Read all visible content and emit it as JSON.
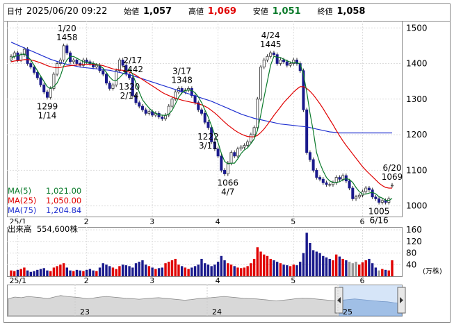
{
  "header": {
    "date_label": "日付",
    "datetime": "2025/06/20 09:22",
    "open_label": "始値",
    "open": "1,057",
    "high_label": "高値",
    "high": "1,069",
    "low_label": "安値",
    "low": "1,051",
    "close_label": "終値",
    "close": "1,058"
  },
  "ma": [
    {
      "label": "MA(5)",
      "value": "1,021.00",
      "color": "#0a7a2a"
    },
    {
      "label": "MA(25)",
      "value": "1,050.00",
      "color": "#e00000"
    },
    {
      "label": "MA(75)",
      "value": "1,204.84",
      "color": "#2030d0"
    }
  ],
  "volume": {
    "label": "出来高",
    "value": "554,600株",
    "unit": "(万株)"
  },
  "colors": {
    "up": "#e00000",
    "down": "#1a1a8c",
    "ma5": "#0a7a2a",
    "ma25": "#e00000",
    "ma75": "#2030d0",
    "vol_gray": "#999999"
  },
  "chart_data": {
    "type": "candlestick",
    "price_axis_ticks": [
      "1500",
      "1400",
      "1300",
      "1200",
      "1100",
      "1000"
    ],
    "price_ylim": [
      970,
      1520
    ],
    "volume_axis_ticks": [
      "160",
      "120",
      "80",
      "40"
    ],
    "volume_ylim": [
      0,
      170
    ],
    "month_labels": [
      "25/1",
      "2",
      "3",
      "4",
      "5",
      "6"
    ],
    "year_labels": [
      "23",
      "24",
      "25"
    ],
    "annotations": [
      {
        "date": "1/20",
        "value": "1458",
        "pos": "above"
      },
      {
        "date": "2/17",
        "value": "1442",
        "pos": "above"
      },
      {
        "date": "3/17",
        "value": "1348",
        "pos": "above"
      },
      {
        "date": "4/24",
        "value": "1445",
        "pos": "above"
      },
      {
        "date": "6/20",
        "value": "1069",
        "pos": "above"
      },
      {
        "date": "1/14",
        "value": "1299",
        "pos": "below"
      },
      {
        "date": "2/14",
        "value": "1320",
        "pos": "below"
      },
      {
        "date": "3/11",
        "value": "1222",
        "pos": "below"
      },
      {
        "date": "4/7",
        "value": "1066",
        "pos": "below"
      },
      {
        "date": "6/16",
        "value": "1005",
        "pos": "below"
      }
    ],
    "candles_close": [
      1420,
      1430,
      1410,
      1425,
      1440,
      1400,
      1390,
      1375,
      1360,
      1340,
      1320,
      1305,
      1330,
      1370,
      1400,
      1410,
      1450,
      1430,
      1405,
      1410,
      1400,
      1395,
      1410,
      1405,
      1400,
      1390,
      1395,
      1380,
      1370,
      1345,
      1330,
      1340,
      1380,
      1410,
      1395,
      1370,
      1360,
      1310,
      1290,
      1280,
      1270,
      1260,
      1265,
      1255,
      1260,
      1250,
      1245,
      1255,
      1280,
      1300,
      1320,
      1330,
      1320,
      1325,
      1330,
      1310,
      1290,
      1270,
      1260,
      1235,
      1220,
      1180,
      1160,
      1140,
      1100,
      1090,
      1120,
      1150,
      1140,
      1160,
      1165,
      1170,
      1180,
      1200,
      1220,
      1300,
      1390,
      1410,
      1420,
      1430,
      1425,
      1400,
      1410,
      1405,
      1395,
      1400,
      1410,
      1400,
      1380,
      1270,
      1150,
      1130,
      1100,
      1080,
      1075,
      1065,
      1060,
      1060,
      1065,
      1080,
      1075,
      1085,
      1070,
      1050,
      1020,
      1025,
      1030,
      1040,
      1050,
      1045,
      1025,
      1020,
      1010,
      1015,
      1010,
      1020,
      1058
    ],
    "candles_open": [
      1410,
      1420,
      1430,
      1410,
      1425,
      1440,
      1400,
      1390,
      1375,
      1360,
      1340,
      1320,
      1305,
      1330,
      1370,
      1400,
      1410,
      1450,
      1430,
      1405,
      1410,
      1400,
      1395,
      1410,
      1405,
      1400,
      1390,
      1395,
      1380,
      1370,
      1345,
      1330,
      1340,
      1380,
      1410,
      1395,
      1370,
      1360,
      1310,
      1290,
      1280,
      1270,
      1260,
      1265,
      1255,
      1260,
      1250,
      1245,
      1255,
      1280,
      1300,
      1320,
      1330,
      1320,
      1325,
      1330,
      1310,
      1290,
      1270,
      1260,
      1235,
      1220,
      1180,
      1160,
      1140,
      1100,
      1090,
      1120,
      1150,
      1140,
      1160,
      1165,
      1170,
      1180,
      1200,
      1220,
      1300,
      1390,
      1410,
      1420,
      1430,
      1425,
      1400,
      1410,
      1405,
      1395,
      1400,
      1410,
      1400,
      1380,
      1270,
      1150,
      1130,
      1100,
      1080,
      1075,
      1065,
      1060,
      1060,
      1065,
      1080,
      1075,
      1085,
      1070,
      1050,
      1020,
      1025,
      1030,
      1040,
      1050,
      1045,
      1025,
      1020,
      1010,
      1015,
      1010,
      1057
    ],
    "ma5": [
      1415,
      1420,
      1422,
      1425,
      1427,
      1420,
      1410,
      1395,
      1380,
      1365,
      1350,
      1335,
      1330,
      1335,
      1345,
      1365,
      1393,
      1410,
      1420,
      1420,
      1415,
      1410,
      1405,
      1402,
      1402,
      1400,
      1398,
      1394,
      1387,
      1375,
      1362,
      1353,
      1352,
      1360,
      1370,
      1377,
      1385,
      1370,
      1345,
      1320,
      1298,
      1286,
      1275,
      1266,
      1260,
      1256,
      1255,
      1254,
      1258,
      1268,
      1286,
      1305,
      1318,
      1324,
      1326,
      1324,
      1318,
      1306,
      1290,
      1270,
      1250,
      1225,
      1200,
      1178,
      1148,
      1125,
      1118,
      1120,
      1120,
      1132,
      1147,
      1157,
      1163,
      1175,
      1188,
      1212,
      1255,
      1305,
      1350,
      1395,
      1420,
      1418,
      1417,
      1412,
      1408,
      1404,
      1402,
      1402,
      1399,
      1370,
      1320,
      1260,
      1210,
      1150,
      1120,
      1098,
      1080,
      1070,
      1066,
      1066,
      1068,
      1073,
      1077,
      1074,
      1066,
      1052,
      1040,
      1033,
      1033,
      1036,
      1038,
      1034,
      1026,
      1022,
      1016,
      1015,
      1021
    ],
    "ma25": [
      1405,
      1407,
      1408,
      1409,
      1411,
      1411,
      1410,
      1408,
      1405,
      1402,
      1398,
      1394,
      1391,
      1389,
      1388,
      1389,
      1391,
      1393,
      1394,
      1395,
      1396,
      1396,
      1397,
      1398,
      1398,
      1398,
      1397,
      1396,
      1394,
      1391,
      1388,
      1385,
      1383,
      1382,
      1381,
      1379,
      1376,
      1372,
      1367,
      1361,
      1355,
      1349,
      1343,
      1337,
      1331,
      1325,
      1319,
      1314,
      1310,
      1306,
      1303,
      1300,
      1297,
      1295,
      1293,
      1291,
      1289,
      1287,
      1284,
      1280,
      1275,
      1268,
      1261,
      1253,
      1244,
      1235,
      1227,
      1220,
      1213,
      1207,
      1202,
      1198,
      1195,
      1194,
      1194,
      1198,
      1206,
      1216,
      1228,
      1241,
      1254,
      1266,
      1278,
      1290,
      1300,
      1310,
      1320,
      1328,
      1335,
      1335,
      1330,
      1322,
      1312,
      1300,
      1287,
      1273,
      1258,
      1243,
      1228,
      1212,
      1197,
      1183,
      1170,
      1158,
      1146,
      1134,
      1122,
      1110,
      1100,
      1091,
      1082,
      1073,
      1064,
      1057,
      1052,
      1050,
      1050
    ],
    "ma75": [
      1460,
      1456,
      1452,
      1448,
      1444,
      1440,
      1436,
      1432,
      1428,
      1424,
      1420,
      1416,
      1412,
      1409,
      1406,
      1403,
      1400,
      1398,
      1396,
      1394,
      1392,
      1390,
      1389,
      1388,
      1387,
      1386,
      1385,
      1384,
      1383,
      1382,
      1381,
      1379,
      1377,
      1375,
      1373,
      1371,
      1369,
      1366,
      1363,
      1360,
      1357,
      1354,
      1351,
      1348,
      1345,
      1342,
      1339,
      1336,
      1333,
      1330,
      1327,
      1324,
      1321,
      1318,
      1315,
      1312,
      1309,
      1306,
      1303,
      1300,
      1297,
      1294,
      1290,
      1286,
      1282,
      1278,
      1274,
      1270,
      1266,
      1262,
      1258,
      1255,
      1252,
      1249,
      1246,
      1244,
      1242,
      1240,
      1238,
      1236,
      1234,
      1232,
      1230,
      1229,
      1228,
      1227,
      1226,
      1225,
      1224,
      1223,
      1222,
      1220,
      1218,
      1216,
      1214,
      1212,
      1210,
      1208,
      1207,
      1206,
      1205,
      1205,
      1205,
      1205,
      1205,
      1205,
      1205,
      1205,
      1205,
      1205,
      1205,
      1205,
      1205,
      1205,
      1205,
      1205,
      1205
    ],
    "volume": [
      20,
      18,
      22,
      25,
      30,
      20,
      15,
      18,
      22,
      25,
      28,
      20,
      18,
      30,
      35,
      40,
      45,
      30,
      20,
      18,
      22,
      20,
      18,
      22,
      25,
      20,
      18,
      30,
      45,
      40,
      35,
      30,
      25,
      35,
      40,
      38,
      35,
      30,
      45,
      50,
      55,
      40,
      35,
      30,
      25,
      28,
      30,
      45,
      50,
      55,
      60,
      40,
      35,
      30,
      25,
      30,
      35,
      40,
      60,
      45,
      40,
      35,
      40,
      50,
      70,
      55,
      45,
      40,
      35,
      30,
      28,
      30,
      35,
      45,
      60,
      100,
      85,
      75,
      70,
      60,
      55,
      50,
      45,
      40,
      38,
      35,
      40,
      38,
      50,
      80,
      150,
      115,
      90,
      85,
      80,
      70,
      65,
      60,
      55,
      75,
      68,
      60,
      55,
      50,
      45,
      50,
      40,
      48,
      55,
      60,
      45,
      30,
      20,
      25,
      22,
      20,
      55
    ],
    "volume_colors": [
      "up",
      "up",
      "down",
      "up",
      "up",
      "down",
      "down",
      "down",
      "down",
      "down",
      "down",
      "down",
      "up",
      "up",
      "up",
      "up",
      "up",
      "down",
      "down",
      "up",
      "down",
      "down",
      "up",
      "down",
      "down",
      "down",
      "up",
      "down",
      "down",
      "down",
      "down",
      "up",
      "up",
      "up",
      "down",
      "down",
      "down",
      "down",
      "down",
      "down",
      "down",
      "down",
      "up",
      "down",
      "up",
      "down",
      "down",
      "up",
      "up",
      "up",
      "up",
      "up",
      "down",
      "up",
      "up",
      "down",
      "down",
      "down",
      "down",
      "down",
      "down",
      "down",
      "down",
      "down",
      "down",
      "down",
      "up",
      "up",
      "down",
      "up",
      "up",
      "up",
      "up",
      "up",
      "up",
      "up",
      "up",
      "up",
      "up",
      "up",
      "down",
      "down",
      "up",
      "down",
      "down",
      "up",
      "up",
      "down",
      "down",
      "down",
      "down",
      "down",
      "down",
      "down",
      "down",
      "down",
      "down",
      "down",
      "up",
      "up",
      "down",
      "up",
      "down",
      "gray",
      "gray",
      "gray",
      "up",
      "up",
      "up",
      "down",
      "down",
      "down",
      "gray",
      "up",
      "down",
      "up",
      "up"
    ],
    "overview": [
      0.55,
      0.6,
      0.58,
      0.62,
      0.6,
      0.58,
      0.55,
      0.6,
      0.65,
      0.62,
      0.6,
      0.58,
      0.55,
      0.57,
      0.6,
      0.62,
      0.6,
      0.58,
      0.56,
      0.55,
      0.53,
      0.55,
      0.57,
      0.58,
      0.56,
      0.54,
      0.52,
      0.5,
      0.52,
      0.55,
      0.57,
      0.58,
      0.6,
      0.62,
      0.6,
      0.58,
      0.56,
      0.55,
      0.54,
      0.52,
      0.5,
      0.48,
      0.5,
      0.52,
      0.55,
      0.57,
      0.56,
      0.54,
      0.52,
      0.5,
      0.48,
      0.5,
      0.52,
      0.54,
      0.52,
      0.5,
      0.48,
      0.46,
      0.45,
      0.42,
      0.4
    ]
  }
}
